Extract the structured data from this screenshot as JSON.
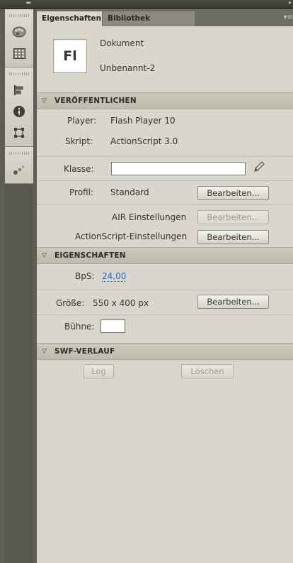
{
  "window": {
    "collapse_glyph": "◂◂",
    "expand_glyph": "▸"
  },
  "toolbar": {
    "tools": [
      {
        "name": "color-palette-icon"
      },
      {
        "name": "swatches-grid-icon"
      },
      {
        "name": "align-icon"
      },
      {
        "name": "info-icon"
      },
      {
        "name": "transform-icon"
      },
      {
        "name": "motion-presets-icon"
      }
    ]
  },
  "tabs": {
    "properties": "Eigenschaften",
    "library": "Bibliothek",
    "menu_glyph": "▾≡"
  },
  "document": {
    "icon_text": "Fl",
    "type": "Dokument",
    "name": "Unbenannt-2"
  },
  "publish": {
    "header": "VERÖFFENTLICHEN",
    "player_label": "Player:",
    "player_value": "Flash Player 10",
    "script_label": "Skript:",
    "script_value": "ActionScript 3.0",
    "class_label": "Klasse:",
    "class_value": "",
    "profile_label": "Profil:",
    "profile_value": "Standard",
    "edit_label": "Bearbeiten...",
    "air_label": "AIR Einstellungen",
    "air_button": "Bearbeiten...",
    "as_label": "ActionScript-Einstellungen",
    "as_button": "Bearbeiten..."
  },
  "properties": {
    "header": "EIGENSCHAFTEN",
    "fps_label": "BpS:",
    "fps_value": "24,00",
    "size_label": "Größe:",
    "size_value": "550 x 400 px",
    "size_button": "Bearbeiten...",
    "stage_label": "Bühne:",
    "stage_color": "#ffffff"
  },
  "swf": {
    "header": "SWF-VERLAUF",
    "log_button": "Log",
    "clear_button": "Löschen"
  },
  "colors": {
    "panel_bg": "#d9d6cb",
    "link_blue": "#2f6ab8"
  }
}
